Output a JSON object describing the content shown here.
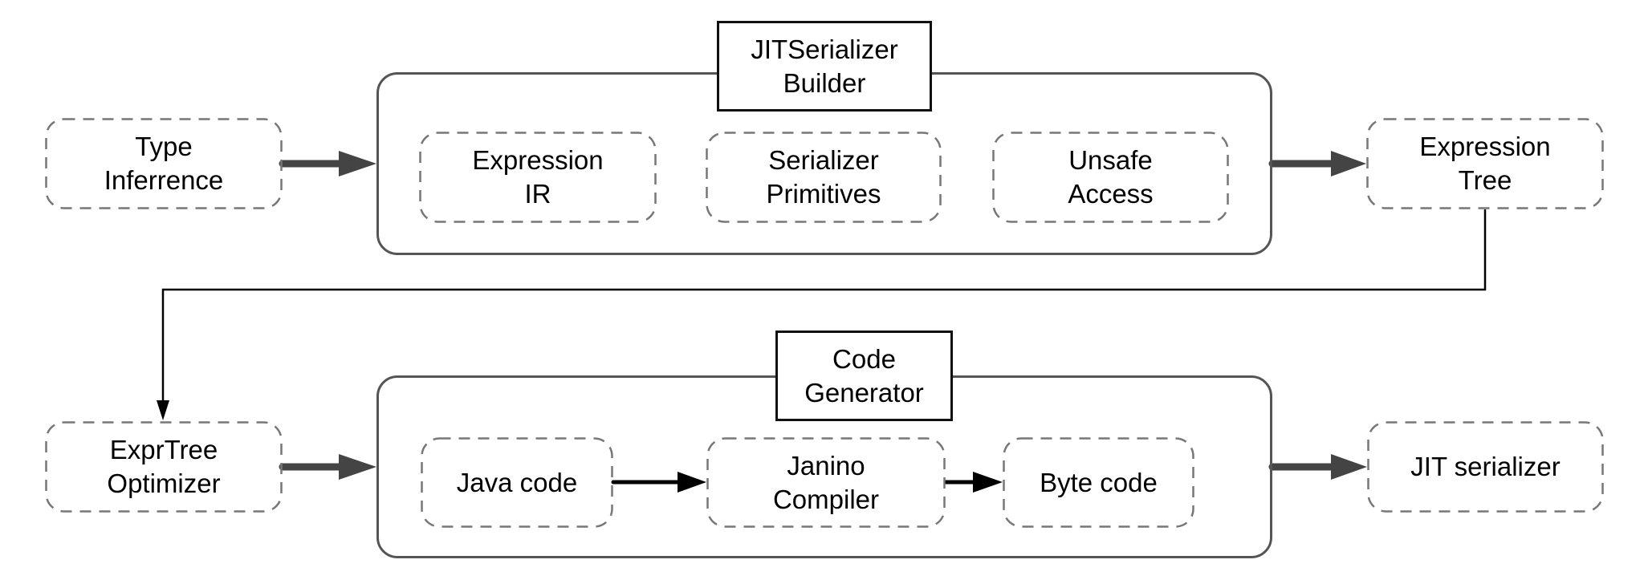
{
  "diagram": {
    "containers": [
      {
        "id": "builder",
        "title": "JITSerializer\nBuilder",
        "children": [
          "Expression\nIR",
          "Serializer\nPrimitives",
          "Unsafe\nAccess"
        ]
      },
      {
        "id": "codegen",
        "title": "Code\nGenerator",
        "children": [
          "Java code",
          "Janino\nCompiler",
          "Byte code"
        ]
      }
    ],
    "nodes": {
      "type_inference": "Type\nInferrence",
      "expression_tree": "Expression\nTree",
      "exprtree_optimizer": "ExprTree\nOptimizer",
      "jit_serializer": "JIT serializer"
    },
    "edges": [
      {
        "from": "Type Inferrence",
        "to": "JITSerializer Builder",
        "style": "thick"
      },
      {
        "from": "JITSerializer Builder",
        "to": "Expression Tree",
        "style": "thick"
      },
      {
        "from": "Expression Tree",
        "to": "ExprTree Optimizer",
        "style": "thin-elbow"
      },
      {
        "from": "ExprTree Optimizer",
        "to": "Code Generator",
        "style": "thick"
      },
      {
        "from": "Java code",
        "to": "Janino Compiler",
        "style": "medium"
      },
      {
        "from": "Janino Compiler",
        "to": "Byte code",
        "style": "medium"
      },
      {
        "from": "Code Generator",
        "to": "JIT serializer",
        "style": "thick"
      }
    ],
    "colors": {
      "thick_arrow": "#444444",
      "thin_arrow": "#000000",
      "dashed_border": "#777777",
      "container_border": "#555555"
    }
  }
}
